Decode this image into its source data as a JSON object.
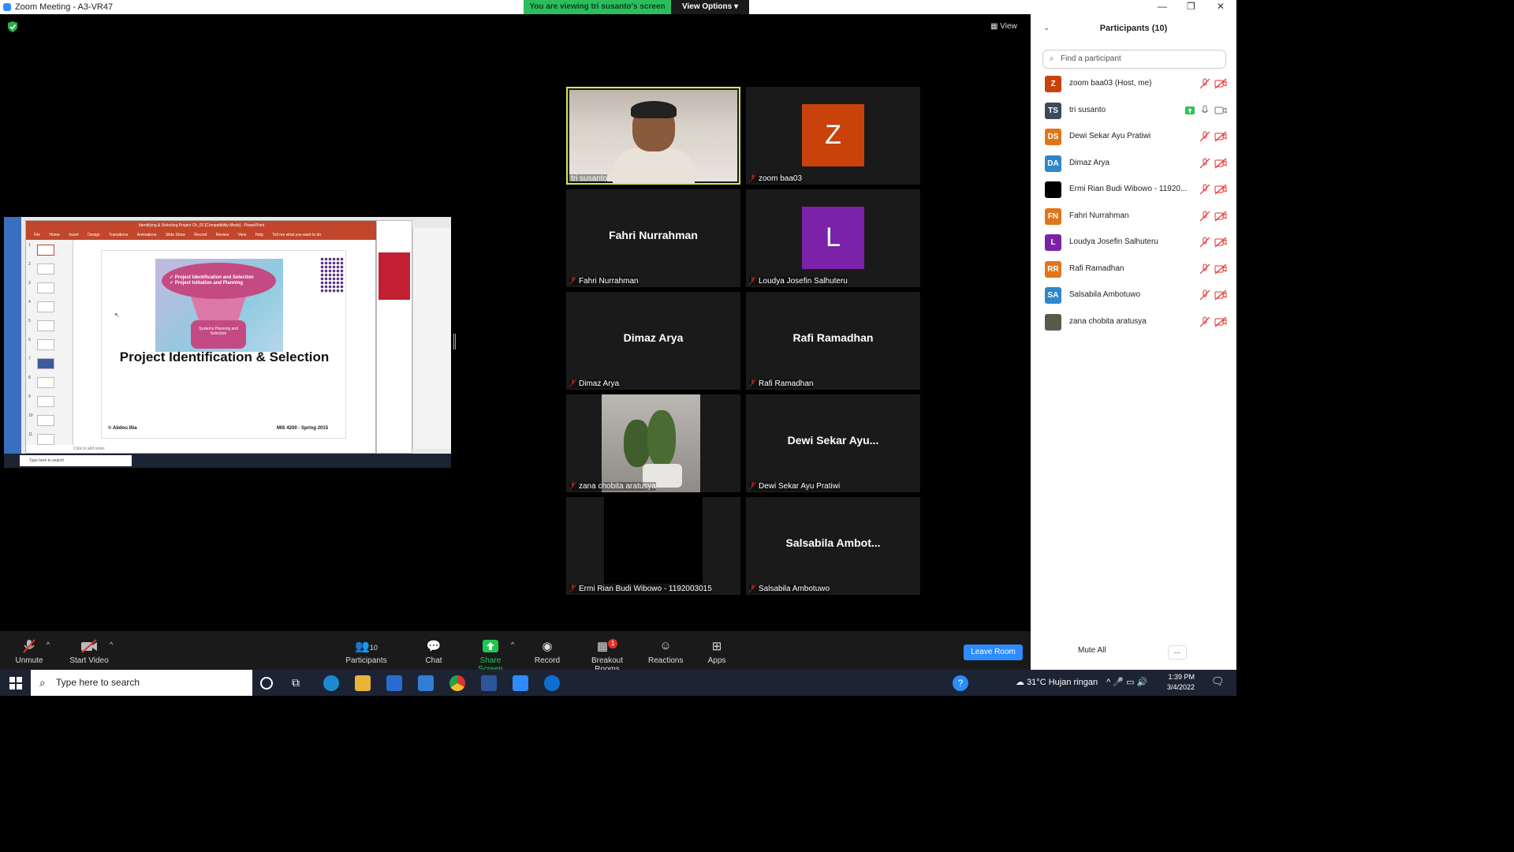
{
  "window": {
    "title": "Zoom Meeting - A3-VR47",
    "minimize": "—",
    "restore": "❐",
    "close": "✕"
  },
  "banner": {
    "text": "You are viewing tri susanto's screen",
    "view_options": "View Options ▾"
  },
  "view_button": "View",
  "shared_screen": {
    "ppt_title": "Identifying & Selecting Project Ch_02 [Compatibility Mode] - PowerPoint",
    "ribbon_tabs": [
      "File",
      "Home",
      "Insert",
      "Design",
      "Transitions",
      "Animations",
      "Slide Show",
      "Record",
      "Review",
      "View",
      "Help",
      "Tell me what you want to do"
    ],
    "slide_bullet_1": "✓ Project Identification and Selection",
    "slide_bullet_2": "✓ Project Initiation and Planning",
    "funnel_text": "Systems Planning and Selection",
    "slide_title": "Project Identification & Selection",
    "slide_author": "© Abdou Illia",
    "slide_course": "MIS 4200 - Spring 2015",
    "notes": "Click to add notes",
    "taskbar_search": "Type here to search",
    "thumb_numbers": [
      "1",
      "2",
      "3",
      "4",
      "5",
      "6",
      "7",
      "8",
      "9",
      "10",
      "11"
    ]
  },
  "tiles": [
    {
      "name": "tri susanto"
    },
    {
      "name": "zoom baa03",
      "initial": "Z",
      "color": "#c9420c"
    },
    {
      "name": "Fahri Nurrahman",
      "display": "Fahri Nurrahman"
    },
    {
      "name": "Loudya Josefin Salhuteru",
      "initial": "L",
      "color": "#7b22a8"
    },
    {
      "name": "Dimaz Arya",
      "display": "Dimaz Arya"
    },
    {
      "name": "Rafi Ramadhan",
      "display": "Rafi Ramadhan"
    },
    {
      "name": "zana chobita aratusya"
    },
    {
      "name": "Dewi Sekar Ayu Pratiwi",
      "display": "Dewi Sekar Ayu..."
    },
    {
      "name": "Ermi Rian Budi Wibowo - 1192003015"
    },
    {
      "name": "Salsabila Ambotuwo",
      "display": "Salsabila Ambot..."
    }
  ],
  "toolbar": {
    "unmute": "Unmute",
    "start_video": "Start Video",
    "participants": "Participants",
    "participants_count": "10",
    "chat": "Chat",
    "share_screen": "Share Screen",
    "record": "Record",
    "breakout_rooms": "Breakout Rooms",
    "breakout_badge": "1",
    "reactions": "Reactions",
    "apps": "Apps",
    "leave_room": "Leave Room"
  },
  "panel": {
    "title": "Participants (10)",
    "search_placeholder": "Find a participant",
    "mute_all": "Mute All",
    "more": "...",
    "participants": [
      {
        "initials": "Z",
        "name": "zoom baa03 (Host, me)",
        "color": "#c9420c"
      },
      {
        "initials": "TS",
        "name": "tri susanto",
        "color": "#3d4a5a"
      },
      {
        "initials": "DS",
        "name": "Dewi Sekar Ayu Pratiwi",
        "color": "#e0761a"
      },
      {
        "initials": "DA",
        "name": "Dimaz Arya",
        "color": "#2f86c9"
      },
      {
        "initials": "",
        "name": "Ermi Rian Budi Wibowo - 11920...",
        "color": "#000000"
      },
      {
        "initials": "FN",
        "name": "Fahri Nurrahman",
        "color": "#e0761a"
      },
      {
        "initials": "L",
        "name": "Loudya Josefin Salhuteru",
        "color": "#7b22a8"
      },
      {
        "initials": "RR",
        "name": "Rafi Ramadhan",
        "color": "#e0761a"
      },
      {
        "initials": "SA",
        "name": "Salsabila Ambotuwo",
        "color": "#2f86c9"
      },
      {
        "initials": "",
        "name": "zana chobita aratusya",
        "color": "#5a5a4a"
      }
    ]
  },
  "taskbar": {
    "search": "Type here to search",
    "weather": "31°C  Hujan ringan",
    "time": "1:39 PM",
    "date": "3/4/2022"
  }
}
